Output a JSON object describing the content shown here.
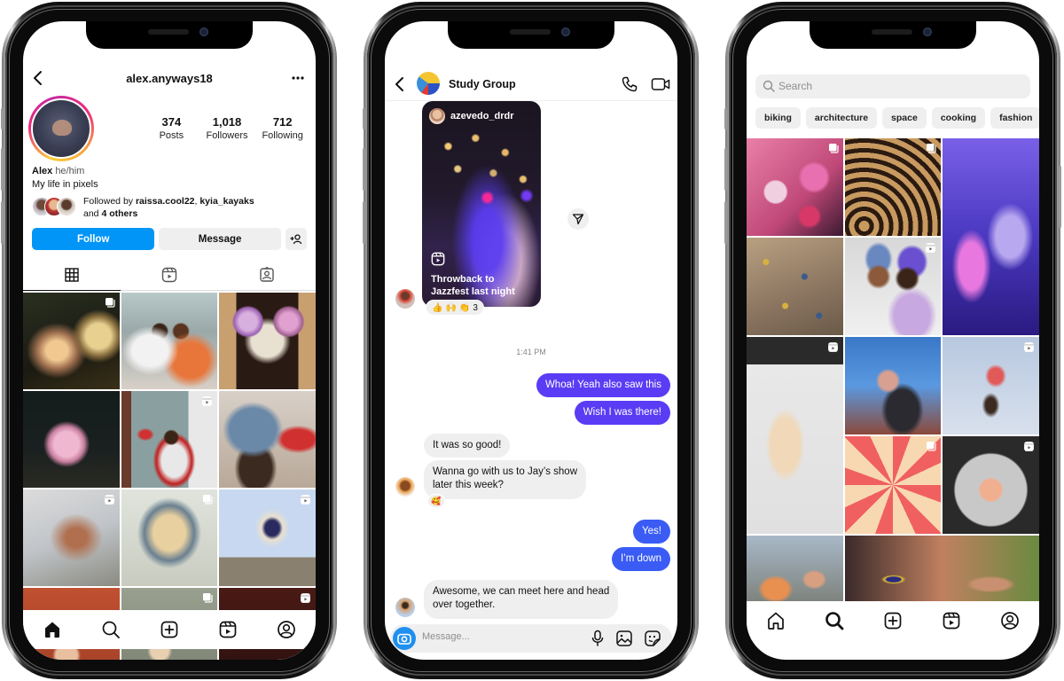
{
  "profile": {
    "username": "alex.anyways18",
    "stats": [
      {
        "value": "374",
        "label": "Posts"
      },
      {
        "value": "1,018",
        "label": "Followers"
      },
      {
        "value": "712",
        "label": "Following"
      }
    ],
    "display_name": "Alex",
    "pronouns": "he/him",
    "bio": "My life in pixels",
    "followed_by_prefix": "Followed by ",
    "followed_by_users": [
      "raissa.cool22",
      "kyia_kayaks"
    ],
    "followed_by_separator": ", ",
    "followed_by_suffix_prefix": "and ",
    "followed_by_others": "4 others",
    "follow_label": "Follow",
    "message_label": "Message",
    "tabs": [
      "grid-icon",
      "reels-icon",
      "tagged-icon"
    ],
    "grid_posts": [
      {
        "badge": "carousel"
      },
      {
        "badge": ""
      },
      {
        "badge": ""
      },
      {
        "badge": ""
      },
      {
        "badge": "reel"
      },
      {
        "badge": ""
      },
      {
        "badge": "reel"
      },
      {
        "badge": "carousel"
      },
      {
        "badge": "reel"
      },
      {
        "badge": ""
      },
      {
        "badge": "carousel"
      },
      {
        "badge": "reel"
      }
    ]
  },
  "dm": {
    "group_name": "Study Group",
    "shared_reel": {
      "author": "azevedo_drdr",
      "caption": "Throwback to Jazzfest last night",
      "reaction_count": "3",
      "reactions": [
        "👍",
        "🙌",
        "👏"
      ]
    },
    "timestamp": "1:41 PM",
    "messages": [
      {
        "from": "me",
        "text": "Whoa! Yeah also saw this"
      },
      {
        "from": "me",
        "text": "Wish I was there!"
      },
      {
        "from": "them",
        "text": "It was so good!"
      },
      {
        "from": "them",
        "text": "Wanna go with us to Jay’s show",
        "text2": "later this week?",
        "reaction": "🥰"
      },
      {
        "from": "me",
        "text": "Yes!"
      },
      {
        "from": "me",
        "text": "I’m down"
      },
      {
        "from": "them",
        "text": "Awesome, we can meet here and head",
        "text2": "over together."
      }
    ],
    "composer_placeholder": "Message..."
  },
  "explore": {
    "search_placeholder": "Search",
    "chips": [
      "biking",
      "architecture",
      "space",
      "cooking",
      "fashion"
    ]
  },
  "tabbar": [
    "home-icon",
    "search-icon",
    "create-icon",
    "reels-icon",
    "profile-icon"
  ],
  "colors": {
    "follow_blue": "#0095f6",
    "outgoing_bubble": "#5b3cf5",
    "outgoing_bubble_late": "#3a5cf5",
    "incoming_bubble": "#efefef"
  }
}
